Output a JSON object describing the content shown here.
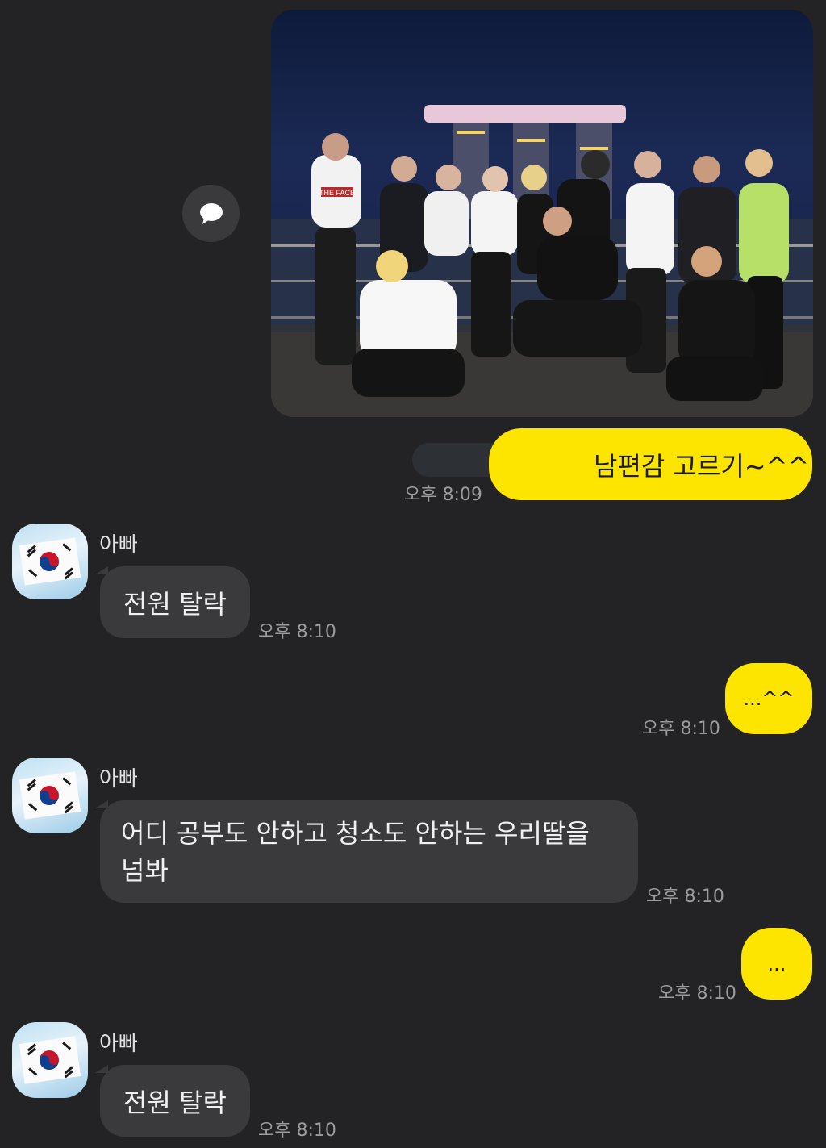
{
  "messages": {
    "m1": {
      "text": "남편감 고르기~^^",
      "time": "오후 8:09"
    },
    "m2": {
      "sender": "아빠",
      "text": "전원 탈락",
      "time": "오후 8:10"
    },
    "m3": {
      "text": "...^^",
      "time": "오후 8:10"
    },
    "m4": {
      "sender": "아빠",
      "text": "어디 공부도 안하고 청소도 안하는 우리딸을 넘봐",
      "time": "오후 8:10"
    },
    "m5": {
      "text": "...",
      "time": "오후 8:10"
    },
    "m6": {
      "sender": "아빠",
      "text": "전원 탈락",
      "time": "오후 8:10"
    }
  },
  "photo": {
    "shirt_text": "THE FACE"
  },
  "colors": {
    "background": "#232325",
    "my_bubble": "#fee500",
    "other_bubble": "#3a3a3c",
    "time_text": "#9c9c9c"
  },
  "icons": {
    "share": "speech-bubble-icon",
    "avatar": "korean-flag-image"
  }
}
